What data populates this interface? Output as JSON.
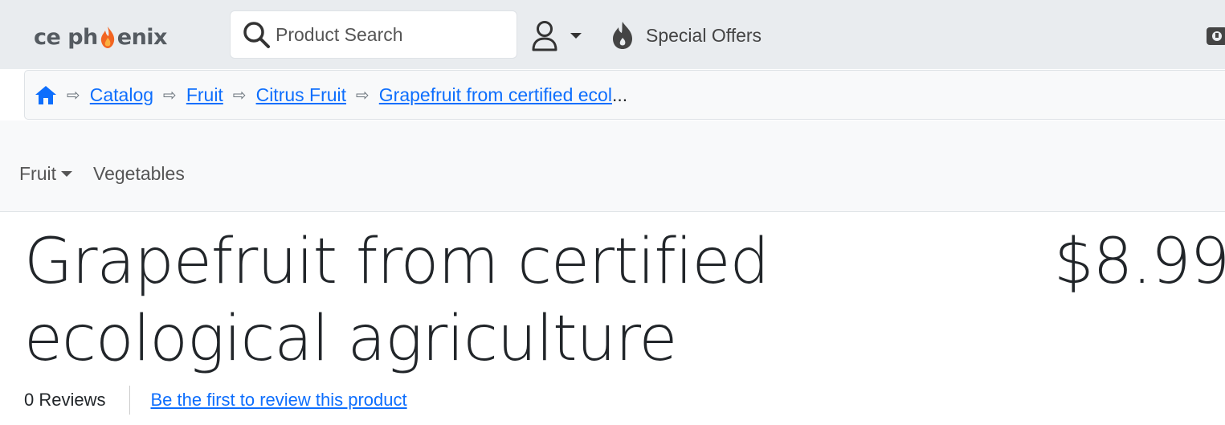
{
  "header": {
    "logo_text_left": "ce ph",
    "logo_text_right": "enix",
    "search_placeholder": "Product Search",
    "special_offers_label": "Special Offers"
  },
  "breadcrumb": {
    "items": [
      "Catalog",
      "Fruit",
      "Citrus Fruit",
      "Grapefruit from certified ecol"
    ],
    "separator": "⇨",
    "truncation": "..."
  },
  "category_nav": {
    "items": [
      {
        "label": "Fruit",
        "has_dropdown": true
      },
      {
        "label": "Vegetables",
        "has_dropdown": false
      }
    ]
  },
  "product": {
    "title": "Grapefruit from certified ecological agriculture",
    "price": "$8.99",
    "reviews_count": "0 Reviews",
    "review_link": "Be the first to review this product"
  },
  "colors": {
    "link": "#0d6efd",
    "topbar_bg": "#e9ecef",
    "logo_flame": "#f26522"
  }
}
